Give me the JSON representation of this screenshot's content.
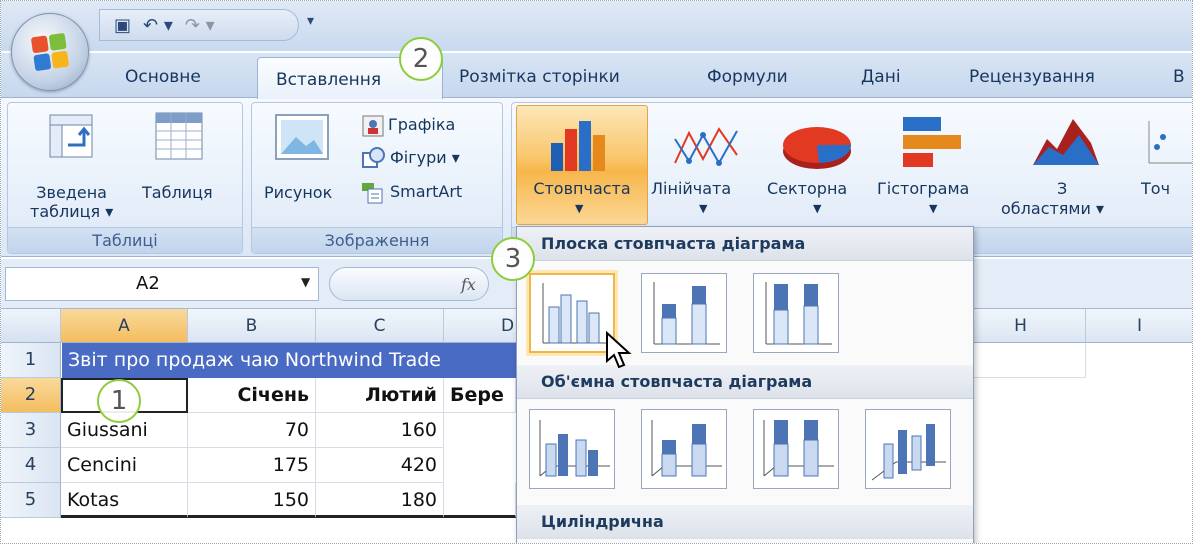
{
  "tabs": [
    "Основне",
    "Вставлення",
    "Розмітка сторінки",
    "Формули",
    "Дані",
    "Рецензування",
    "В"
  ],
  "ribbon": {
    "pivot_label_1": "Зведена",
    "pivot_label_2": "таблиця ▾",
    "table_label": "Таблиця",
    "group_tables": "Таблиці",
    "picture_label": "Рисунок",
    "clipart_label": "Графіка",
    "shapes_label": "Фігури ▾",
    "smartart_label": "SmartArt",
    "group_images": "Зображення",
    "charts": [
      "Стовпчаста",
      "Лінійчата",
      "Секторна",
      "Гістограма"
    ],
    "area_label_1": "З",
    "area_label_2": "областями ▾",
    "scatter_label": "Точ"
  },
  "formula_bar": {
    "name_box": "A2",
    "fx": "fx"
  },
  "columns": [
    "A",
    "B",
    "C",
    "D",
    "H",
    "I"
  ],
  "rows": [
    "1",
    "2",
    "3",
    "4",
    "5"
  ],
  "sheet": {
    "title": "Звіт про продаж чаю Northwind Trade",
    "headers": [
      "Січень",
      "Лютий",
      "Бере"
    ],
    "data": [
      {
        "name": "Giussani",
        "jan": "70",
        "feb": "160"
      },
      {
        "name": "Cencini",
        "jan": "175",
        "feb": "420"
      },
      {
        "name": "Kotas",
        "jan": "150",
        "feb": "180"
      }
    ]
  },
  "dropdown": {
    "section_2d": "Плоска стовпчаста діаграма",
    "section_3d": "Об'ємна стовпчаста діаграма",
    "section_cyl": "Циліндрична"
  },
  "callouts": [
    "1",
    "2",
    "3"
  ],
  "colors": {
    "accent": "#4a6bc4",
    "highlight": "#f7b64a",
    "callout_ring": "#8ccd3b"
  }
}
